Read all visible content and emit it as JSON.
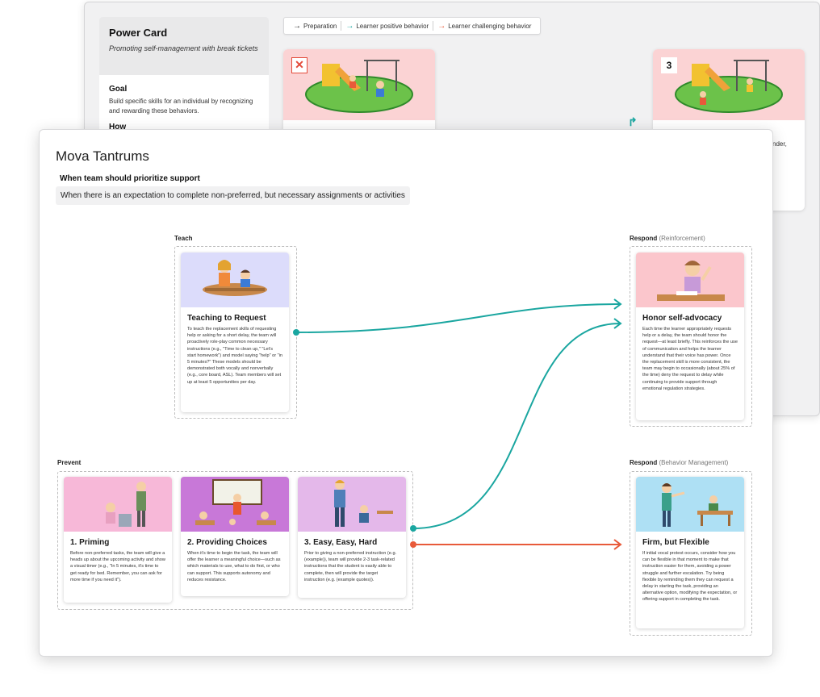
{
  "background": {
    "card_title": "Power Card",
    "card_subtitle": "Promoting self-management with break tickets",
    "goal_label": "Goal",
    "goal_text": "Build specific skills for an individual by recognizing and rewarding these behaviors.",
    "how_label": "How",
    "legend": [
      {
        "label": "Preparation",
        "color": "#222222"
      },
      {
        "label": "Learner positive behavior",
        "color": "#1aa6a0"
      },
      {
        "label": "Learner challenging behavior",
        "color": "#e85a3a"
      }
    ],
    "tile_right_number": "3",
    "tile_right_text": "nder,"
  },
  "main": {
    "title": "Mova Tantrums",
    "priority_label": "When team should prioritize support",
    "priority_text": "When there is an expectation to complete non-preferred, but necessary assignments or activities",
    "sections": {
      "teach": "Teach",
      "respond_reinforcement_main": "Respond",
      "respond_reinforcement_sub": "(Reinforcement)",
      "prevent": "Prevent",
      "respond_bm_main": "Respond",
      "respond_bm_sub": "(Behavior Management)"
    },
    "tiles": {
      "teaching": {
        "title": "Teaching to Request",
        "desc": "To teach the replacement skills of requesting help or asking for a short delay, the team will proactively role-play common necessary instructions (e.g., \"Time to clean up,\" \"Let's start homework\") and model saying \"help\" or \"in 5 minutes?\" These models should be demonstrated both vocally and nonverbally (e.g., core board, ASL). Team members will set up at least 5 opportunities per day."
      },
      "honor": {
        "title": "Honor self-advocacy",
        "desc": "Each time the learner appropriately requests help or a delay, the team should honor the request—at least briefly. This reinforces the use of communication and helps the learner understand that their voice has power. Once the replacement skill is more consistent, the team may begin to occasionally (about 25% of the time) deny the request to delay while continuing to provide support through emotional regulation strategies."
      },
      "priming": {
        "title": "1. Priming",
        "desc": "Before non-preferred tasks, the team will give a heads up about the upcoming activity and show a visual timer (e.g., \"In 5 minutes, it's time to get ready for bed. Remember, you can ask for more time if you need it\")."
      },
      "choices": {
        "title": "2. Providing Choices",
        "desc": "When it's time to begin the task, the team will offer the learner a meaningful choice—such as which materials to use, what to do first, or who can support. This supports autonomy and reduces resistance."
      },
      "easy": {
        "title": "3. Easy, Easy, Hard",
        "desc": "Prior to giving a non-preferred instruction (e.g. (example)), team will provide 2-3 task-related instructions that the student is easily able to complete, then will provide the target instruction (e.g. (example quotes))."
      },
      "firm": {
        "title": "Firm, but Flexible",
        "desc": "If initial vocal protest occurs, consider how you can be flexible in that moment to make that instruction easier for them, avoiding a power struggle and further escalation. Try being flexible by reminding them they can request a delay in starting the task, providing an alternative option, modifying the expectation, or offering support in completing the task."
      }
    },
    "colors": {
      "positive": "#1aa6a0",
      "challenging": "#e85a3a"
    }
  }
}
